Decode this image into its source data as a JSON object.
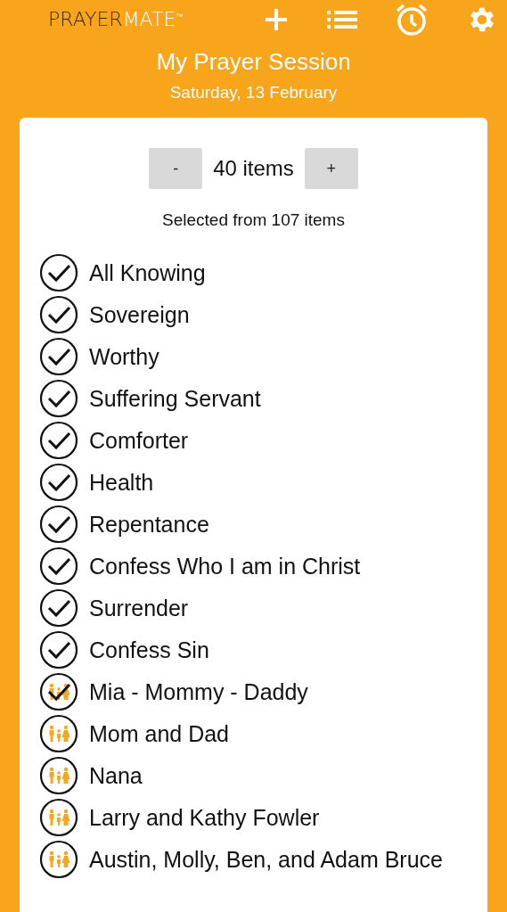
{
  "header": {
    "logo": {
      "dark": "PRAYER",
      "light": "MATE",
      "mark": "™"
    },
    "title": "My Prayer Session",
    "date": "Saturday, 13 February"
  },
  "stepper": {
    "minus": "-",
    "count": "40 items",
    "plus": "+"
  },
  "summary": "Selected from 107 items",
  "items": [
    {
      "label": "All Knowing",
      "kind": "topic",
      "checked": true
    },
    {
      "label": "Sovereign",
      "kind": "topic",
      "checked": true
    },
    {
      "label": "Worthy",
      "kind": "topic",
      "checked": true
    },
    {
      "label": "Suffering Servant",
      "kind": "topic",
      "checked": true
    },
    {
      "label": "Comforter",
      "kind": "topic",
      "checked": true
    },
    {
      "label": "Health",
      "kind": "topic",
      "checked": true
    },
    {
      "label": "Repentance",
      "kind": "topic",
      "checked": true
    },
    {
      "label": "Confess Who I am in Christ",
      "kind": "topic",
      "checked": true
    },
    {
      "label": "Surrender",
      "kind": "topic",
      "checked": true
    },
    {
      "label": "Confess Sin",
      "kind": "topic",
      "checked": true
    },
    {
      "label": "Mia - Mommy - Daddy",
      "kind": "people",
      "checked": true
    },
    {
      "label": "Mom and Dad",
      "kind": "people",
      "checked": false
    },
    {
      "label": "Nana",
      "kind": "people",
      "checked": false
    },
    {
      "label": "Larry and Kathy Fowler",
      "kind": "people",
      "checked": false
    },
    {
      "label": "Austin, Molly, Ben, and Adam Bruce",
      "kind": "people",
      "checked": false
    }
  ]
}
